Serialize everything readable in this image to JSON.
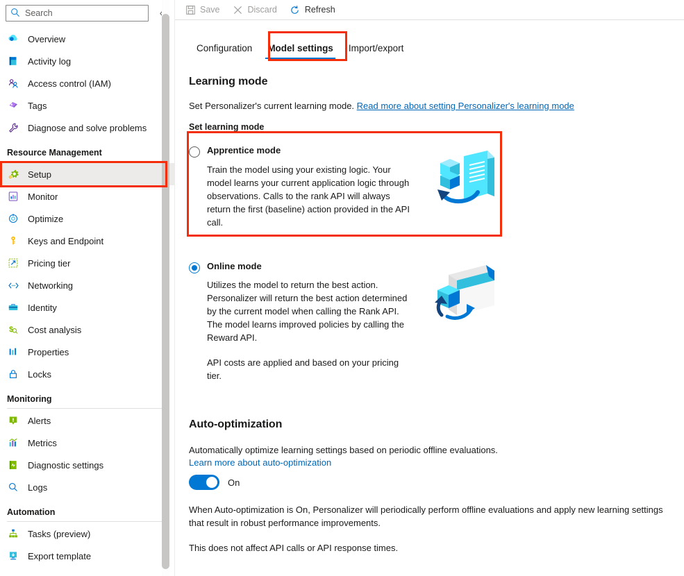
{
  "search": {
    "placeholder": "Search",
    "icon": "search-icon"
  },
  "collapse": {
    "icon": "chevron-double-left-icon"
  },
  "sidebar": {
    "items": [
      {
        "label": "Overview",
        "icon": "overview-cloud-icon",
        "selected": false
      },
      {
        "label": "Activity log",
        "icon": "activity-log-icon",
        "selected": false
      },
      {
        "label": "Access control (IAM)",
        "icon": "access-control-icon",
        "selected": false
      },
      {
        "label": "Tags",
        "icon": "tags-icon",
        "selected": false
      },
      {
        "label": "Diagnose and solve problems",
        "icon": "wrench-icon",
        "selected": false
      }
    ],
    "groups": [
      {
        "title": "Resource Management",
        "items": [
          {
            "label": "Setup",
            "icon": "gear-icon",
            "selected": true
          },
          {
            "label": "Monitor",
            "icon": "monitor-chart-icon",
            "selected": false
          },
          {
            "label": "Optimize",
            "icon": "optimize-icon",
            "selected": false
          },
          {
            "label": "Keys and Endpoint",
            "icon": "key-icon",
            "selected": false
          },
          {
            "label": "Pricing tier",
            "icon": "pricing-tier-icon",
            "selected": false
          },
          {
            "label": "Networking",
            "icon": "networking-icon",
            "selected": false
          },
          {
            "label": "Identity",
            "icon": "identity-icon",
            "selected": false
          },
          {
            "label": "Cost analysis",
            "icon": "cost-analysis-icon",
            "selected": false
          },
          {
            "label": "Properties",
            "icon": "properties-icon",
            "selected": false
          },
          {
            "label": "Locks",
            "icon": "lock-icon",
            "selected": false
          }
        ]
      },
      {
        "title": "Monitoring",
        "items": [
          {
            "label": "Alerts",
            "icon": "alert-icon",
            "selected": false
          },
          {
            "label": "Metrics",
            "icon": "metrics-icon",
            "selected": false
          },
          {
            "label": "Diagnostic settings",
            "icon": "diagnostic-settings-icon",
            "selected": false
          },
          {
            "label": "Logs",
            "icon": "logs-search-icon",
            "selected": false
          }
        ]
      },
      {
        "title": "Automation",
        "items": [
          {
            "label": "Tasks (preview)",
            "icon": "tasks-icon",
            "selected": false
          },
          {
            "label": "Export template",
            "icon": "export-template-icon",
            "selected": false
          }
        ]
      }
    ]
  },
  "commandbar": {
    "save": {
      "label": "Save",
      "icon": "save-disk-icon",
      "disabled": true
    },
    "discard": {
      "label": "Discard",
      "icon": "close-x-icon",
      "disabled": true
    },
    "refresh": {
      "label": "Refresh",
      "icon": "refresh-circular-arrow-icon",
      "disabled": false
    }
  },
  "tabs": [
    {
      "label": "Configuration",
      "active": false
    },
    {
      "label": "Model settings",
      "active": true
    },
    {
      "label": "Import/export",
      "active": false
    }
  ],
  "learning_mode": {
    "heading": "Learning mode",
    "description": "Set Personalizer's current learning mode.",
    "doc_link": "Read more about setting Personalizer's learning mode",
    "field_label": "Set learning mode",
    "options": [
      {
        "id": "apprentice",
        "title": "Apprentice mode",
        "selected": false,
        "description": "Train the model using your existing logic. Your model learns your current application logic through observations. Calls to the rank API will always return the first (baseline) action provided in the API call.",
        "art": "apprentice-mode-illustration"
      },
      {
        "id": "online",
        "title": "Online mode",
        "selected": true,
        "description": "Utilizes the model to return the best action. Personalizer will return the best action determined by the current model when calling the Rank API. The model learns improved policies by calling the Reward API.",
        "description2": "API costs are applied and based on your pricing tier.",
        "art": "online-mode-illustration"
      }
    ]
  },
  "auto_optimization": {
    "heading": "Auto-optimization",
    "description": "Automatically optimize learning settings based on periodic offline evaluations.",
    "doc_link": "Learn more about auto-optimization",
    "toggle_state": "On",
    "toggle_on": true,
    "note1": "When Auto-optimization is On, Personalizer will periodically perform offline evaluations and apply new learning settings that result in robust performance improvements.",
    "note2": "This does not affect API calls or API response times."
  },
  "annotations": {
    "accent": "#f42e0a",
    "boxes": [
      "setup-nav-item",
      "model-settings-tab",
      "apprentice-mode-option"
    ]
  },
  "colors": {
    "azure_blue": "#0078d4",
    "link_blue": "#0067b8",
    "highlight_red": "#f42e0a",
    "selected_nav_bg": "#edebe9"
  }
}
